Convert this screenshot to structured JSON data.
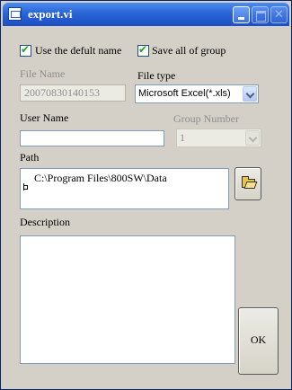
{
  "window": {
    "title": "export.vi"
  },
  "options": {
    "use_default_name_label": "Use the defult name",
    "use_default_name_checked": true,
    "save_all_group_label": "Save all of group",
    "save_all_group_checked": true
  },
  "file_name": {
    "label": "File Name",
    "value": "20070830140153",
    "disabled": true
  },
  "file_type": {
    "label": "File type",
    "selected": "Microsoft Excel(*.xls)"
  },
  "user_name": {
    "label": "User Name",
    "value": ""
  },
  "group_number": {
    "label": "Group Number",
    "selected": "1",
    "disabled": true
  },
  "path": {
    "label": "Path",
    "value": "C:\\Program Files\\800SW\\Data"
  },
  "description": {
    "label": "Description",
    "value": ""
  },
  "ok_button": {
    "label": "OK"
  },
  "icons": {
    "window_icon": "app-window-icon",
    "browse_icon": "folder-open-icon",
    "path_type_icon": "path-symbol-icon"
  },
  "colors": {
    "titlebar": "#2a64d6",
    "check_mark": "#21a121",
    "window_bg": "#d4d0c8",
    "disabled_text": "#8d8d8d"
  }
}
